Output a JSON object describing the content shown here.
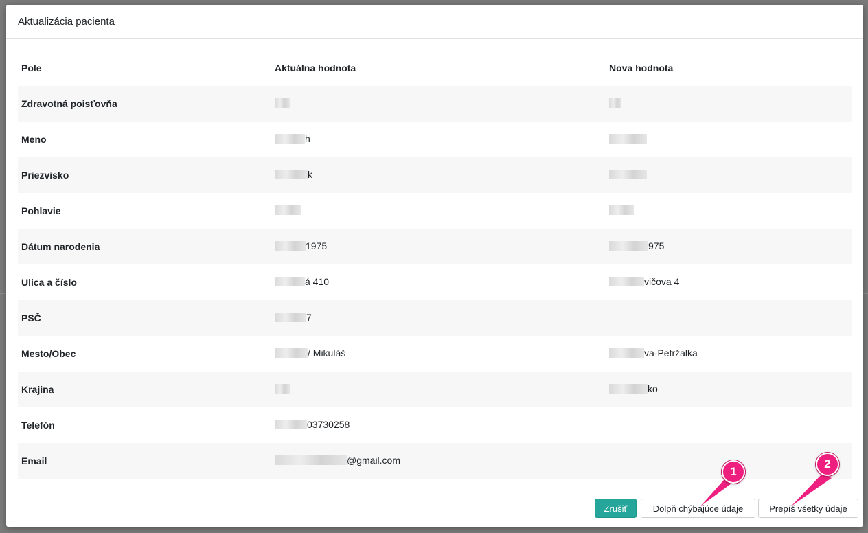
{
  "dialog": {
    "title": "Aktualizácia pacienta"
  },
  "table": {
    "headers": [
      "Pole",
      "Aktuálna hodnota",
      "Nova hodnota"
    ],
    "rows": [
      {
        "field": "Zdravotná poisťovňa",
        "current": "",
        "new": ""
      },
      {
        "field": "Meno",
        "current": "h",
        "new": ""
      },
      {
        "field": "Priezvisko",
        "current": "k",
        "new": ""
      },
      {
        "field": "Pohlavie",
        "current": "",
        "new": ""
      },
      {
        "field": "Dátum narodenia",
        "current": "1975",
        "new": "975"
      },
      {
        "field": "Ulica a číslo",
        "current": "á 410",
        "new": "vičova 4"
      },
      {
        "field": "PSČ",
        "current": "7",
        "new": ""
      },
      {
        "field": "Mesto/Obec",
        "current": "/ Mikuláš",
        "new": "va-Petržalka"
      },
      {
        "field": "Krajina",
        "current": "",
        "new": "ko"
      },
      {
        "field": "Telefón",
        "current": "03730258",
        "new": ""
      },
      {
        "field": "Email",
        "current": "@gmail.com",
        "new": ""
      }
    ]
  },
  "footer": {
    "cancel_label": "Zrušiť",
    "fill_missing_label": "Dolpň chýbajúce údaje",
    "overwrite_all_label": "Prepíš všetky údaje"
  },
  "annotations": {
    "badge_1": "1",
    "badge_2": "2",
    "accent_color": "#ef1f7f"
  },
  "colors": {
    "primary": "#26a69a",
    "stripe": "#f7f7f7",
    "overlay": "#7b7b7b"
  }
}
